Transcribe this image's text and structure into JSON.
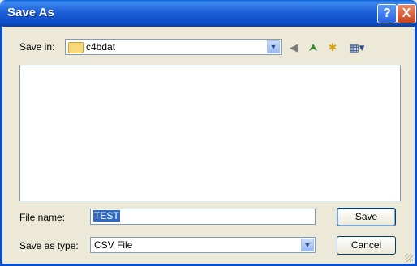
{
  "window": {
    "title": "Save As"
  },
  "titlebar_buttons": {
    "help": "?",
    "close": "X"
  },
  "savein": {
    "label": "Save in:",
    "value": "c4bdat",
    "icon": "folder-icon"
  },
  "toolbar": {
    "icons": [
      "back-icon",
      "up-folder-icon",
      "new-folder-icon",
      "views-menu-icon"
    ]
  },
  "filename": {
    "label": "File name:",
    "value": "TEST"
  },
  "savetype": {
    "label": "Save as type:",
    "value": "CSV File"
  },
  "buttons": {
    "save": "Save",
    "cancel": "Cancel"
  },
  "colors": {
    "titlebar": "#0b4fc8",
    "dialog_bg": "#ece9d8",
    "selection": "#316ac5"
  }
}
